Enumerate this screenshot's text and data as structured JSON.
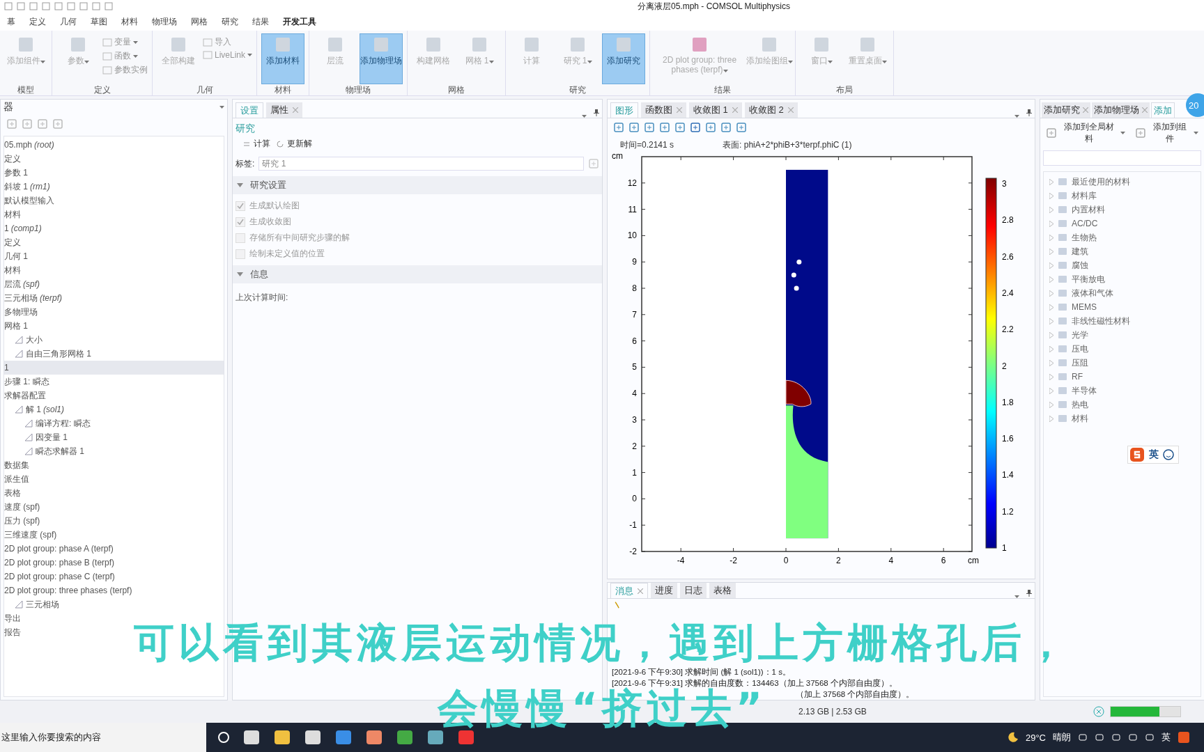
{
  "window": {
    "title": "分离液层05.mph - COMSOL Multiphysics"
  },
  "menu": [
    {
      "label": "幕",
      "selected": false
    },
    {
      "label": "定义",
      "selected": false
    },
    {
      "label": "几何",
      "selected": false
    },
    {
      "label": "草图",
      "selected": false
    },
    {
      "label": "材料",
      "selected": false
    },
    {
      "label": "物理场",
      "selected": false
    },
    {
      "label": "网格",
      "selected": false
    },
    {
      "label": "研究",
      "selected": false
    },
    {
      "label": "结果",
      "selected": false
    },
    {
      "label": "开发工具",
      "selected": true
    }
  ],
  "ribbon": [
    {
      "label": "模型",
      "items": [
        {
          "kind": "large",
          "label": "添加组件",
          "selected": false,
          "dropdown": true
        }
      ]
    },
    {
      "label": "定义",
      "items": [
        {
          "kind": "large",
          "label": "参数",
          "selected": false,
          "dropdown": true
        },
        {
          "kind": "small",
          "label": "变量",
          "dropdown": true
        },
        {
          "kind": "small",
          "label": "函数",
          "dropdown": true
        },
        {
          "kind": "small",
          "label": "参数实例"
        }
      ]
    },
    {
      "label": "几何",
      "items": [
        {
          "kind": "large",
          "label": "全部构建",
          "selected": false
        },
        {
          "kind": "small",
          "label": "导入"
        },
        {
          "kind": "small",
          "label": "LiveLink",
          "dropdown": true
        }
      ]
    },
    {
      "label": "材料",
      "items": [
        {
          "kind": "large",
          "label": "添加材料",
          "selected": true
        }
      ]
    },
    {
      "label": "物理场",
      "items": [
        {
          "kind": "large",
          "label": "层流",
          "selected": false
        },
        {
          "kind": "large",
          "label": "添加物理场",
          "selected": true
        }
      ]
    },
    {
      "label": "网格",
      "items": [
        {
          "kind": "large",
          "label": "构建网格",
          "selected": false
        },
        {
          "kind": "large",
          "label": "网格 1",
          "selected": false,
          "dropdown": true
        }
      ]
    },
    {
      "label": "研究",
      "items": [
        {
          "kind": "large",
          "label": "计算",
          "selected": false
        },
        {
          "kind": "large",
          "label": "研究 1",
          "selected": false,
          "dropdown": true
        },
        {
          "kind": "large",
          "label": "添加研究",
          "selected": true
        }
      ]
    },
    {
      "label": "结果",
      "items": [
        {
          "kind": "large",
          "label": "2D plot group: three phases (terpf)",
          "selected": false,
          "dropdown": true
        },
        {
          "kind": "large",
          "label": "添加绘图组",
          "selected": false,
          "dropdown": true
        }
      ]
    },
    {
      "label": "布局",
      "items": [
        {
          "kind": "large",
          "label": "窗口",
          "selected": false,
          "dropdown": true
        },
        {
          "kind": "large",
          "label": "重置桌面",
          "selected": false,
          "dropdown": true
        }
      ]
    }
  ],
  "model_builder": {
    "title": "器",
    "tree": [
      {
        "label": "05.mph *(root)*",
        "selected": false
      },
      {
        "label": "定义",
        "selected": false
      },
      {
        "label": "参数 1",
        "selected": false
      },
      {
        "label": "斜坡 1 *(rm1)*",
        "selected": false
      },
      {
        "label": "默认模型输入",
        "selected": false
      },
      {
        "label": "材料",
        "selected": false
      },
      {
        "label": "1 *(comp1)*",
        "selected": false
      },
      {
        "label": "定义",
        "selected": false
      },
      {
        "label": "几何 1",
        "selected": false
      },
      {
        "label": "材料",
        "selected": false
      },
      {
        "label": "层流 *(spf)*",
        "selected": false
      },
      {
        "label": "三元相场 *(terpf)*",
        "selected": false
      },
      {
        "label": "多物理场",
        "selected": false
      },
      {
        "label": "网格 1",
        "selected": false,
        "children": [
          {
            "label": "大小",
            "selected": false
          },
          {
            "label": "自由三角形网格 1",
            "selected": false
          }
        ]
      },
      {
        "label": "1",
        "selected": true
      },
      {
        "label": "步骤 1: 瞬态",
        "selected": false
      },
      {
        "label": "求解器配置",
        "selected": false,
        "children": [
          {
            "label": "解 1 *(sol1)*",
            "selected": false,
            "children": [
              {
                "label": "编译方程: 瞬态",
                "selected": false
              },
              {
                "label": "因变量 1",
                "selected": false
              },
              {
                "label": "瞬态求解器 1",
                "selected": false
              }
            ]
          }
        ]
      },
      {
        "label": "数据集",
        "selected": false
      },
      {
        "label": "派生值",
        "selected": false
      },
      {
        "label": "表格",
        "selected": false
      },
      {
        "label": "速度 (spf)",
        "selected": false
      },
      {
        "label": "压力 (spf)",
        "selected": false
      },
      {
        "label": "三维速度 (spf)",
        "selected": false
      },
      {
        "label": "2D plot group: phase A (terpf)",
        "selected": false
      },
      {
        "label": "2D plot group: phase B (terpf)",
        "selected": false
      },
      {
        "label": "2D plot group: phase C (terpf)",
        "selected": false
      },
      {
        "label": "2D plot group: three phases (terpf)",
        "selected": false,
        "children": [
          {
            "label": "三元相场",
            "selected": false
          }
        ]
      },
      {
        "label": "导出",
        "selected": false
      },
      {
        "label": "报告",
        "selected": false
      }
    ]
  },
  "settings": {
    "tabs": [
      {
        "label": "设置",
        "selected": true,
        "closable": false
      },
      {
        "label": "属性",
        "selected": false,
        "closable": true
      }
    ],
    "heading": "研究",
    "actions": [
      "计算",
      "更新解"
    ],
    "label_field": {
      "label": "标签:",
      "value": "研究 1"
    },
    "sections": [
      {
        "title": "研究设置",
        "expanded": true,
        "checkboxes": [
          {
            "label": "生成默认绘图",
            "checked": true
          },
          {
            "label": "生成收敛图",
            "checked": true
          },
          {
            "label": "存储所有中间研究步骤的解",
            "checked": false
          },
          {
            "label": "绘制未定义值的位置",
            "checked": false
          }
        ]
      },
      {
        "title": "信息",
        "expanded": true,
        "text": "上次计算时间:"
      }
    ]
  },
  "graphics": {
    "tabs": [
      {
        "label": "图形",
        "selected": true,
        "closable": false
      },
      {
        "label": "函数图",
        "selected": false,
        "closable": true
      },
      {
        "label": "收敛图 1",
        "selected": false,
        "closable": true
      },
      {
        "label": "收敛图 2",
        "selected": false,
        "closable": true
      }
    ],
    "time_label": "时间=0.2141 s",
    "surface_label": "表面: phiA+2*phiB+3*terpf.phiC (1)",
    "y_unit": "cm",
    "x_unit": "cm",
    "xticks": [
      "-4",
      "-2",
      "0",
      "2",
      "4",
      "6"
    ],
    "yticks": [
      "12",
      "11",
      "10",
      "9",
      "8",
      "7",
      "6",
      "5",
      "4",
      "3",
      "2",
      "1",
      "0",
      "-1",
      "-2"
    ],
    "colorbar_ticks": [
      "3",
      "2.8",
      "2.6",
      "2.4",
      "2.2",
      "2",
      "1.8",
      "1.6",
      "1.4",
      "1.2",
      "1"
    ]
  },
  "messages": {
    "tabs": [
      {
        "label": "消息",
        "selected": true,
        "closable": true
      },
      {
        "label": "进度",
        "selected": false,
        "closable": false
      },
      {
        "label": "日志",
        "selected": false,
        "closable": false
      },
      {
        "label": "表格",
        "selected": false,
        "closable": false
      }
    ],
    "lines": [
      {
        "kind": "full",
        "text": "[2021-9-6 下午9:30] 求解时间 (解 1 (sol1))：1 s。"
      },
      {
        "kind": "full",
        "text": "[2021-9-6 下午9:31] 求解的自由度数：134463（加上 37568 个内部自由度）。"
      },
      {
        "kind": "tail",
        "text": "（加上 37568 个内部自由度）。"
      }
    ]
  },
  "add_material": {
    "tabs": [
      {
        "label": "添加研究",
        "selected": false,
        "closable": true
      },
      {
        "label": "添加物理场",
        "selected": false,
        "closable": true
      },
      {
        "label": "添加",
        "selected": true,
        "closable": false
      }
    ],
    "actions": [
      "添加到全局材料",
      "添加到组件"
    ],
    "items": [
      "最近使用的材料",
      "材料库",
      "内置材料",
      "AC/DC",
      "生物热",
      "建筑",
      "腐蚀",
      "平衡放电",
      "液体和气体",
      "MEMS",
      "非线性磁性材料",
      "光学",
      "压电",
      "压阻",
      "RF",
      "半导体",
      "热电",
      "材料"
    ]
  },
  "badge": "20",
  "ime": {
    "label": "英"
  },
  "status_bar": {
    "memory": "2.13 GB | 2.53 GB",
    "level": 0.7
  },
  "subtitle": [
    "可以看到其液层运动情况，遇到上方栅格孔后，",
    "会慢慢“挤过去”"
  ],
  "taskbar": {
    "search_placeholder": "这里输入你要搜索的内容",
    "weather": "29°C",
    "weather_text": "晴朗",
    "ime": "英"
  }
}
